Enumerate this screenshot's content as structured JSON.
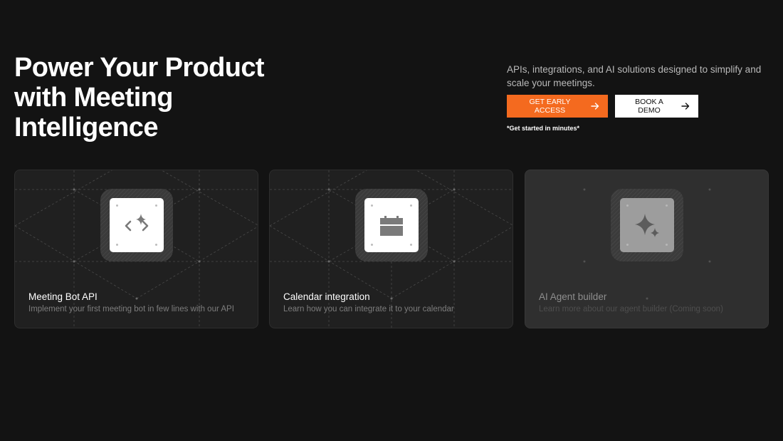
{
  "hero": {
    "title_lines": [
      "Power Your Product",
      "with Meeting",
      "Intelligence"
    ],
    "subtitle": "APIs, integrations, and AI solutions designed to simplify and scale your meetings.",
    "primary_cta": "GET EARLY ACCESS",
    "secondary_cta": "BOOK A DEMO",
    "note": "*Get started in minutes*"
  },
  "cards": [
    {
      "title": "Meeting Bot API",
      "description": "Implement your first meeting bot in few lines with our API",
      "icon": "code-sparkle-icon"
    },
    {
      "title": "Calendar integration",
      "description": "Learn how you can integrate it to your calendar",
      "icon": "calendar-icon"
    },
    {
      "title": "AI Agent builder",
      "description": "Learn more about our agent builder  (Coming soon)",
      "icon": "sparkle-icon"
    }
  ],
  "colors": {
    "background": "#131313",
    "accent": "#f46a1f",
    "card": "#202020",
    "card_disabled": "#2f2f2f"
  }
}
